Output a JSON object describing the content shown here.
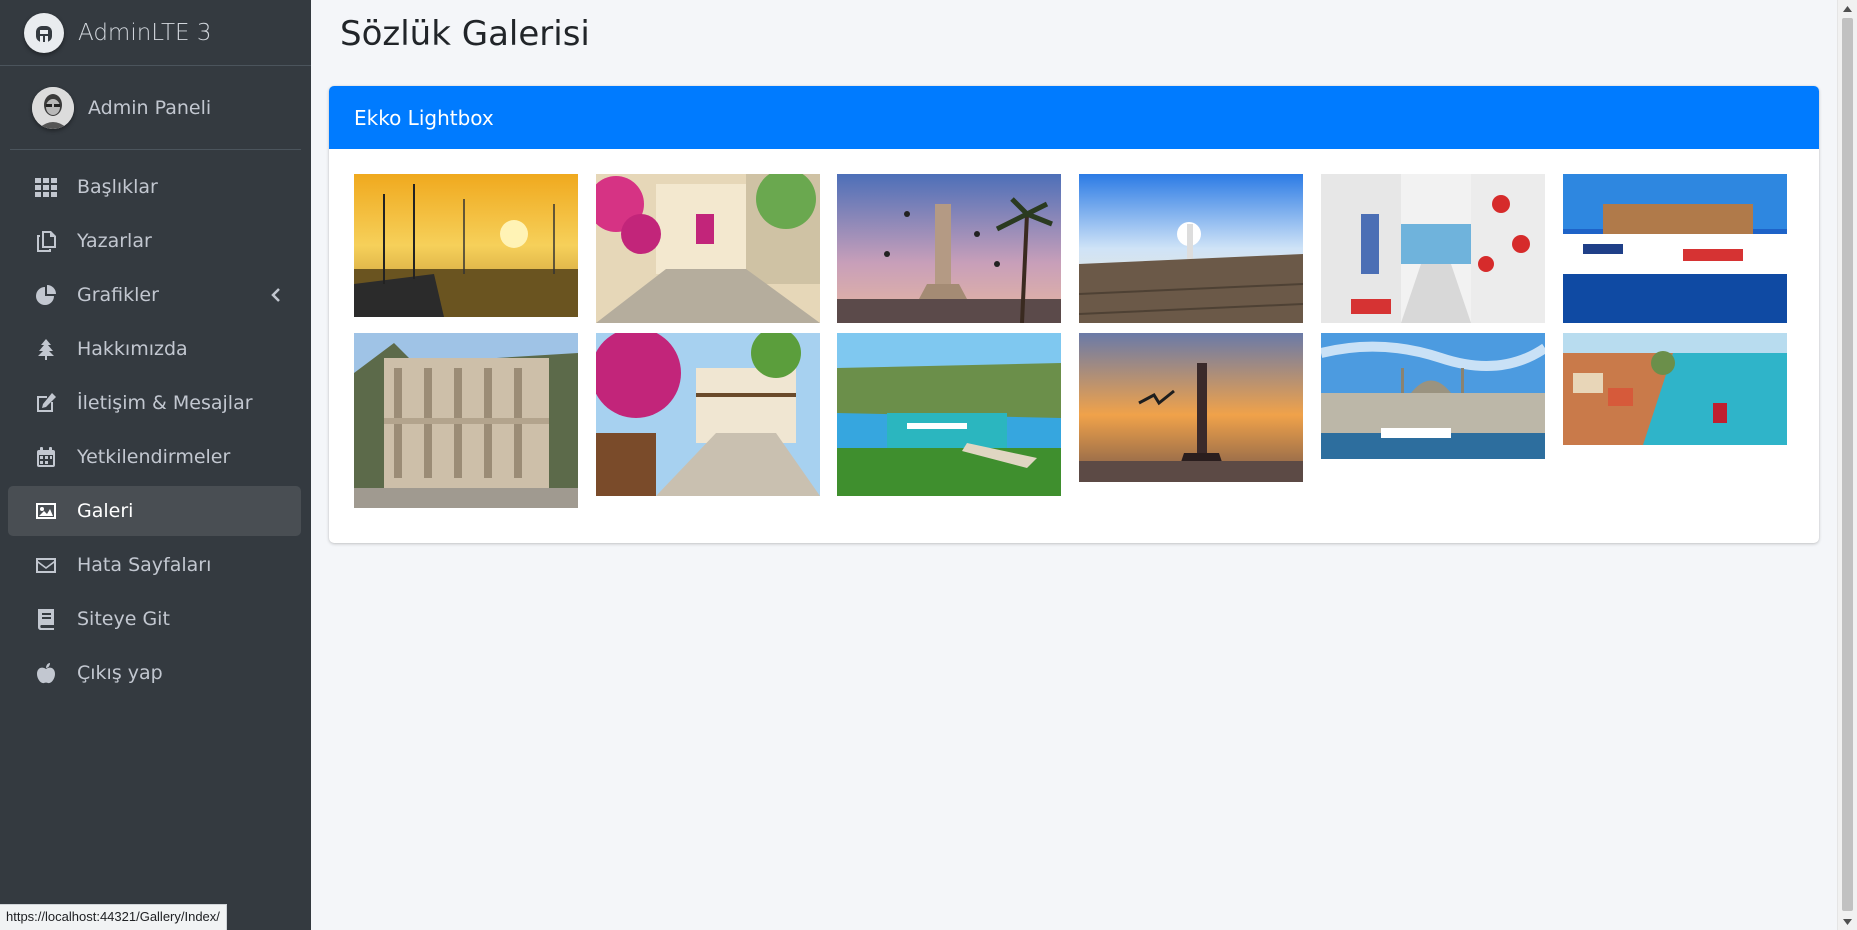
{
  "app": {
    "brand": "AdminLTE 3"
  },
  "user": {
    "name": "Admin Paneli"
  },
  "sidebar": {
    "items": [
      {
        "label": "Başlıklar",
        "icon": "grid-icon"
      },
      {
        "label": "Yazarlar",
        "icon": "copy-icon"
      },
      {
        "label": "Grafikler",
        "icon": "pie-chart-icon"
      },
      {
        "label": "Hakkımızda",
        "icon": "tree-icon"
      },
      {
        "label": "İletişim & Mesajlar",
        "icon": "edit-icon"
      },
      {
        "label": "Yetkilendirmeler",
        "icon": "calendar-icon"
      },
      {
        "label": "Galeri",
        "icon": "image-icon",
        "active": true
      },
      {
        "label": "Hata Sayfaları",
        "icon": "envelope-icon"
      },
      {
        "label": "Siteye Git",
        "icon": "book-icon"
      },
      {
        "label": "Çıkış yap",
        "icon": "apple-icon"
      }
    ]
  },
  "page": {
    "title": "Sözlük Galerisi"
  },
  "card": {
    "title": "Ekko Lightbox"
  },
  "status_bar": {
    "url": "https://localhost:44321/Gallery/Index/"
  },
  "colors": {
    "primary": "#007bff",
    "sidebar_bg": "#343a40",
    "content_bg": "#f4f6f9"
  }
}
